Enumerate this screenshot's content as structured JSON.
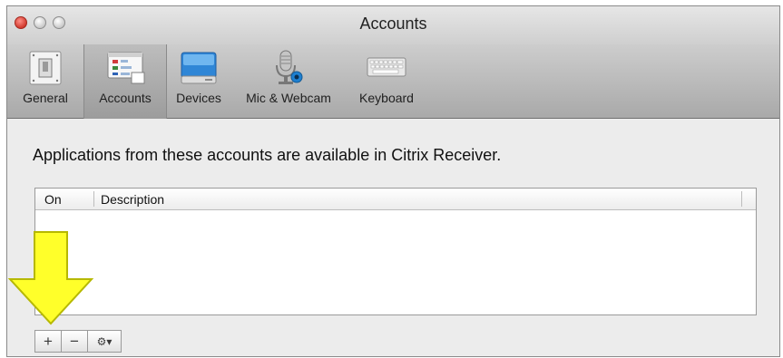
{
  "window": {
    "title": "Accounts"
  },
  "toolbar": {
    "items": [
      {
        "label": "General",
        "icon": "toggle-switch-icon"
      },
      {
        "label": "Accounts",
        "icon": "accounts-window-icon",
        "selected": true
      },
      {
        "label": "Devices",
        "icon": "drive-icon"
      },
      {
        "label": "Mic & Webcam",
        "icon": "mic-webcam-icon"
      },
      {
        "label": "Keyboard",
        "icon": "keyboard-icon"
      }
    ]
  },
  "content": {
    "description": "Applications from these accounts are available in Citrix Receiver."
  },
  "table": {
    "columns": [
      "On",
      "Description"
    ],
    "rows": []
  },
  "buttons": {
    "add_label": "+",
    "remove_label": "−",
    "action_label": "⚙▾"
  },
  "colors": {
    "annotation_arrow": "#ffff2a",
    "annotation_arrow_outline": "#b6b800",
    "close_button": "#d13a2e"
  }
}
